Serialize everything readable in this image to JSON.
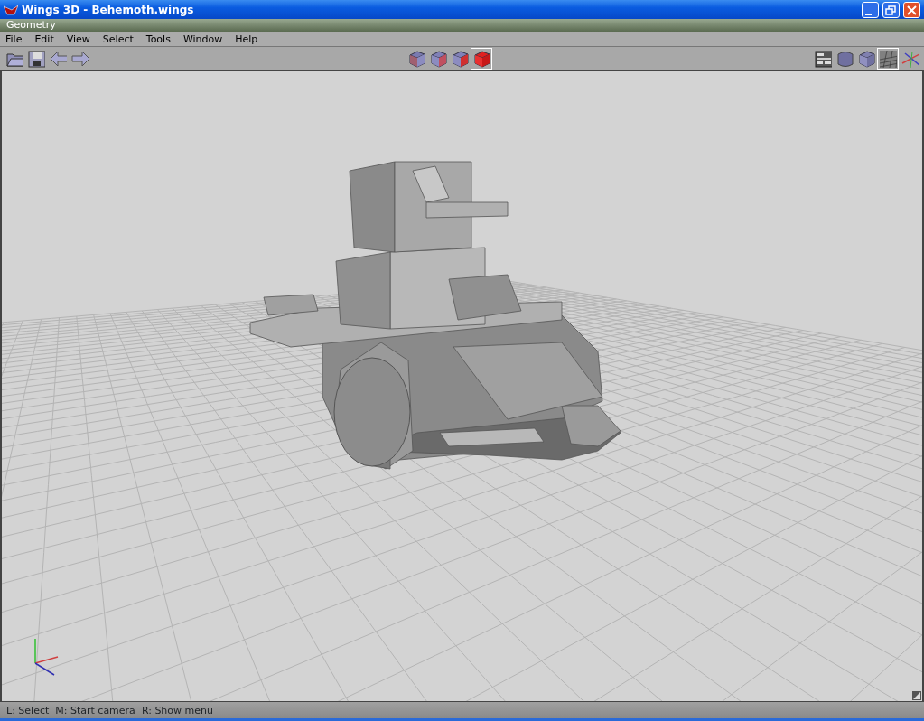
{
  "window": {
    "title": "Wings 3D - Behemoth.wings"
  },
  "viewport": {
    "title": "Geometry"
  },
  "menu": [
    "File",
    "Edit",
    "View",
    "Select",
    "Tools",
    "Window",
    "Help"
  ],
  "toolbar_left": [
    {
      "kind": "open"
    },
    {
      "kind": "save"
    },
    {
      "kind": "undo"
    },
    {
      "kind": "redo"
    }
  ],
  "selection_modes": [
    {
      "kind": "vertex",
      "selected": false
    },
    {
      "kind": "edge",
      "selected": false
    },
    {
      "kind": "face",
      "selected": false
    },
    {
      "kind": "body",
      "selected": true
    }
  ],
  "toolbar_right": [
    {
      "kind": "workmode",
      "selected": false
    },
    {
      "kind": "smooth",
      "selected": false
    },
    {
      "kind": "flat",
      "selected": false
    },
    {
      "kind": "groundplane",
      "selected": true
    },
    {
      "kind": "axes",
      "selected": false
    }
  ],
  "status_bar": [
    "L: Select",
    "M: Start camera",
    "R: Show menu"
  ]
}
